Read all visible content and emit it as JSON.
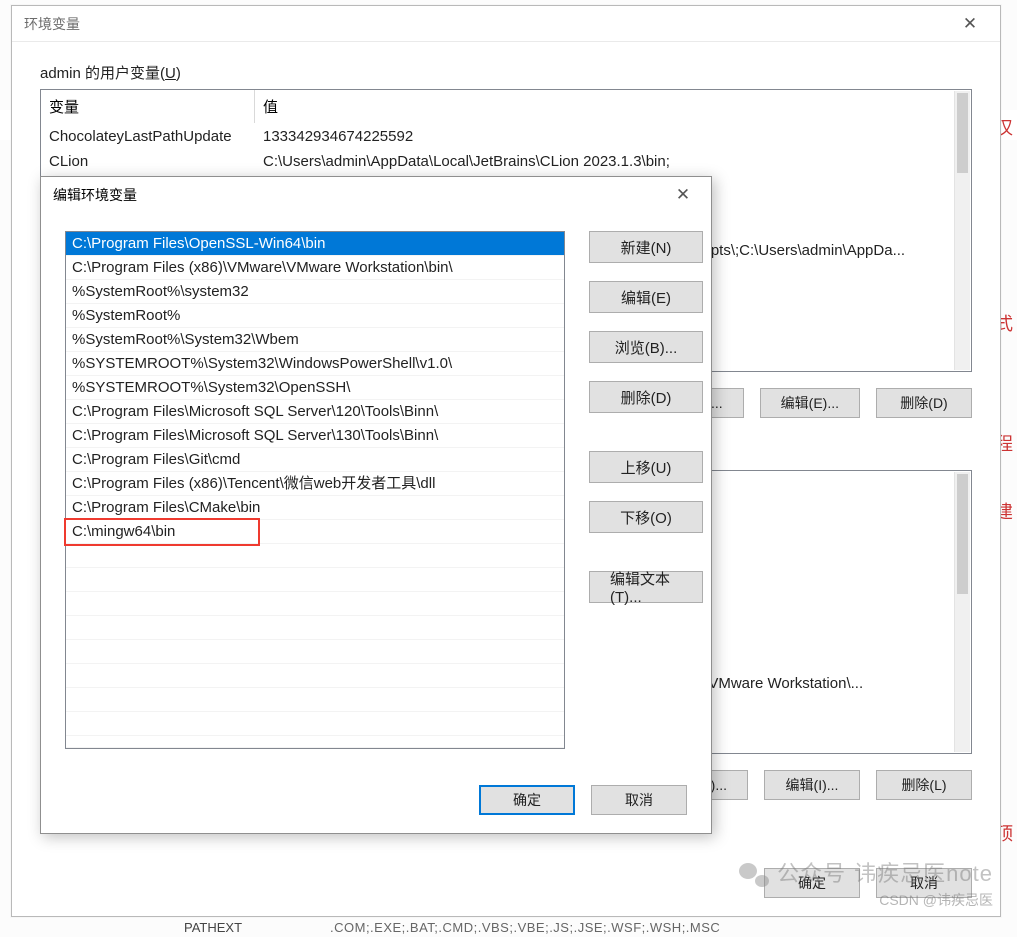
{
  "outer": {
    "title": "环境变量",
    "user_section_label_prefix": "admin 的用户变量(",
    "user_section_label_u": "U",
    "user_section_label_suffix": ")",
    "user_table": {
      "head_var": "变量",
      "head_val": "值",
      "rows": [
        {
          "var": "ChocolateyLastPathUpdate",
          "val": "133342934674225592"
        },
        {
          "var": "CLion",
          "val": "C:\\Users\\admin\\AppData\\Local\\JetBrains\\CLion 2023.1.3\\bin;"
        },
        {
          "var": "",
          "val": "Scripts\\;C:\\Users\\admin\\AppDa..."
        }
      ]
    },
    "sys_table_visible_row": {
      "val": "/Mware\\VMware Workstation\\..."
    },
    "buttons": {
      "new_n": "新建(N)...",
      "edit_e": "编辑(E)...",
      "delete_d": "删除(D)",
      "edit_i": "编辑(I)...",
      "delete_l": "删除(L)",
      "ok": "确定",
      "cancel": "取消"
    }
  },
  "inner": {
    "title": "编辑环境变量",
    "paths": [
      "C:\\Program Files\\OpenSSL-Win64\\bin",
      "C:\\Program Files (x86)\\VMware\\VMware Workstation\\bin\\",
      "%SystemRoot%\\system32",
      "%SystemRoot%",
      "%SystemRoot%\\System32\\Wbem",
      "%SYSTEMROOT%\\System32\\WindowsPowerShell\\v1.0\\",
      "%SYSTEMROOT%\\System32\\OpenSSH\\",
      "C:\\Program Files\\Microsoft SQL Server\\120\\Tools\\Binn\\",
      "C:\\Program Files\\Microsoft SQL Server\\130\\Tools\\Binn\\",
      "C:\\Program Files\\Git\\cmd",
      "C:\\Program Files (x86)\\Tencent\\微信web开发者工具\\dll",
      "C:\\Program Files\\CMake\\bin",
      "C:\\mingw64\\bin"
    ],
    "selected_index": 0,
    "highlight_index": 12,
    "buttons": {
      "new": "新建(N)",
      "edit": "编辑(E)",
      "browse": "浏览(B)...",
      "delete": "删除(D)",
      "move_up": "上移(U)",
      "move_down": "下移(O)",
      "edit_text": "编辑文本(T)...",
      "ok": "确定",
      "cancel": "取消"
    }
  },
  "background": {
    "bottom_label": "PATHEXT",
    "bottom_value": ".COM;.EXE;.BAT;.CMD;.VBS;.VBE;.JS;.JSE;.WSF;.WSH;.MSC",
    "right_frag_1": "汉",
    "right_frag_2": "式",
    "right_frag_3": "程",
    "right_frag_4": "建",
    "right_frag_5": "顶"
  },
  "watermark": {
    "line1_prefix": "公众号",
    "line1_name": "讳疾忌医note",
    "line2": "CSDN @讳疾忌医"
  }
}
